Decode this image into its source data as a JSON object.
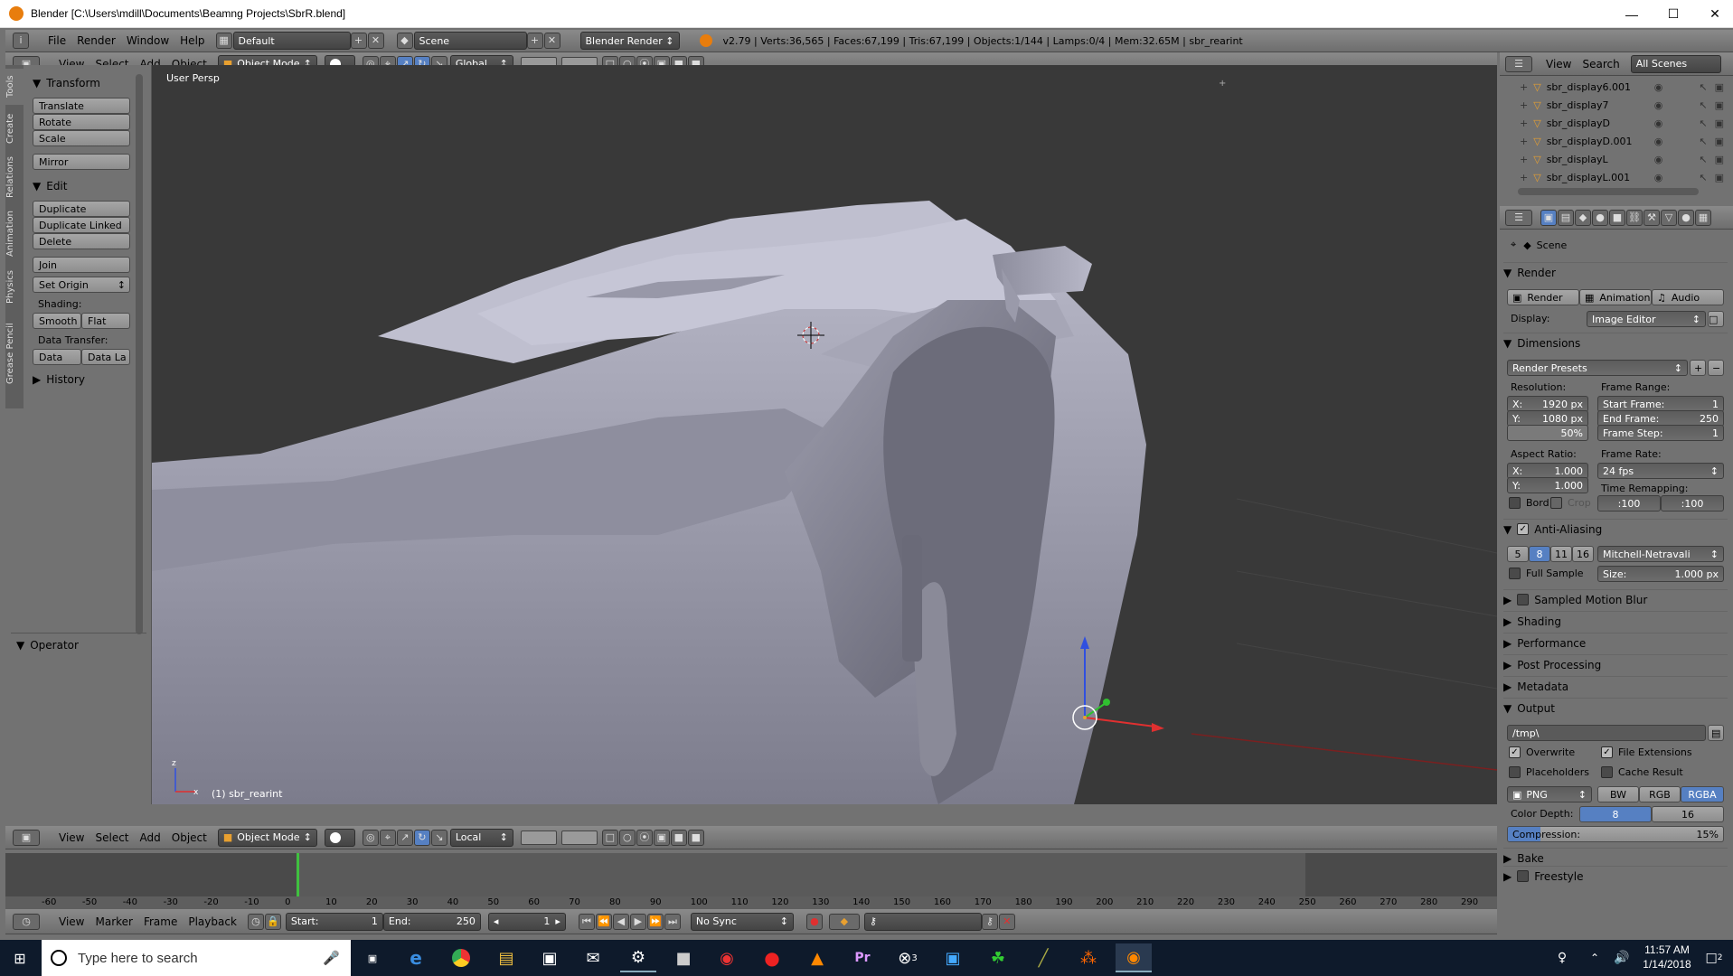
{
  "window": {
    "title": "Blender [C:\\Users\\mdill\\Documents\\Beamng Projects\\SbrR.blend]"
  },
  "info_bar": {
    "menus": [
      "File",
      "Render",
      "Window",
      "Help"
    ],
    "layout": "Default",
    "scene": "Scene",
    "engine": "Blender Render",
    "stats": "v2.79 | Verts:36,565 | Faces:67,199 | Tris:67,199 | Objects:1/144 | Lamps:0/4 | Mem:32.65M | sbr_rearint"
  },
  "view3d_header": {
    "menus": [
      "View",
      "Select",
      "Add",
      "Object"
    ],
    "mode": "Object Mode",
    "orientation": "Global"
  },
  "view3d_header_bottom": {
    "menus": [
      "View",
      "Select",
      "Add",
      "Object"
    ],
    "mode": "Object Mode",
    "orientation": "Local"
  },
  "tool_tabs": [
    "Tools",
    "Create",
    "Relations",
    "Animation",
    "Physics",
    "Grease Pencil"
  ],
  "toolshelf": {
    "transform": {
      "title": "Transform",
      "buttons": [
        "Translate",
        "Rotate",
        "Scale",
        "Mirror"
      ]
    },
    "edit": {
      "title": "Edit",
      "buttons": [
        "Duplicate",
        "Duplicate Linked",
        "Delete",
        "Join"
      ],
      "set_origin": "Set Origin"
    },
    "shading": {
      "label": "Shading:",
      "smooth": "Smooth",
      "flat": "Flat"
    },
    "data_transfer": {
      "label": "Data Transfer:",
      "data": "Data",
      "data_la": "Data La"
    },
    "history": "History",
    "operator": "Operator"
  },
  "viewport": {
    "label": "User Persp",
    "object_label": "(1) sbr_rearint",
    "axis_x": "x",
    "axis_z": "z"
  },
  "outliner": {
    "menus": [
      "View",
      "Search"
    ],
    "filter": "All Scenes",
    "items": [
      "sbr_display6.001",
      "sbr_display7",
      "sbr_displayD",
      "sbr_displayD.001",
      "sbr_displayL",
      "sbr_displayL.001"
    ]
  },
  "properties": {
    "context": "Scene",
    "render": {
      "title": "Render",
      "buttons": [
        "Render",
        "Animation",
        "Audio"
      ],
      "display_label": "Display:",
      "display_value": "Image Editor"
    },
    "dimensions": {
      "title": "Dimensions",
      "presets": "Render Presets",
      "resolution_label": "Resolution:",
      "res_x": "X:",
      "res_x_val": "1920 px",
      "res_y": "Y:",
      "res_y_val": "1080 px",
      "res_pct": "50%",
      "frame_range_label": "Frame Range:",
      "start_frame": "Start Frame:",
      "start_val": "1",
      "end_frame": "End Frame:",
      "end_val": "250",
      "frame_step": "Frame Step:",
      "step_val": "1",
      "aspect_label": "Aspect Ratio:",
      "asp_x": "X:",
      "asp_x_val": "1.000",
      "asp_y": "Y:",
      "asp_y_val": "1.000",
      "frame_rate_label": "Frame Rate:",
      "frame_rate": "24 fps",
      "time_remap_label": "Time Remapping:",
      "remap_old": ":100",
      "remap_new": ":100",
      "bord": "Bord",
      "crop": "Crop"
    },
    "anti_aliasing": {
      "title": "Anti-Aliasing",
      "samples": [
        "5",
        "8",
        "11",
        "16"
      ],
      "filter": "Mitchell-Netravali",
      "full_sample": "Full Sample",
      "size_label": "Size:",
      "size_val": "1.000 px"
    },
    "collapsed": [
      "Sampled Motion Blur",
      "Shading",
      "Performance",
      "Post Processing",
      "Metadata"
    ],
    "output": {
      "title": "Output",
      "path": "/tmp\\",
      "overwrite": "Overwrite",
      "file_extensions": "File Extensions",
      "placeholders": "Placeholders",
      "cache_result": "Cache Result",
      "format": "PNG",
      "color_modes": [
        "BW",
        "RGB",
        "RGBA"
      ],
      "color_depth_label": "Color Depth:",
      "depths": [
        "8",
        "16"
      ],
      "compression_label": "Compression:",
      "compression": "15%",
      "compression_value": 0.15
    },
    "bake": "Bake",
    "freestyle": "Freestyle"
  },
  "timeline": {
    "ticks": [
      "-60",
      "-50",
      "-40",
      "-30",
      "-20",
      "-10",
      "0",
      "10",
      "20",
      "30",
      "40",
      "50",
      "60",
      "70",
      "80",
      "90",
      "100",
      "110",
      "120",
      "130",
      "140",
      "150",
      "160",
      "170",
      "180",
      "190",
      "200",
      "210",
      "220",
      "230",
      "240",
      "250",
      "260",
      "270",
      "280",
      "290"
    ],
    "menus": [
      "View",
      "Marker",
      "Frame",
      "Playback"
    ],
    "start_label": "Start:",
    "start_val": "1",
    "end_label": "End:",
    "end_val": "250",
    "current": "1",
    "sync": "No Sync"
  },
  "taskbar": {
    "search_placeholder": "Type here to search",
    "time": "11:57 AM",
    "date": "1/14/2018",
    "notif_count": "2",
    "xbox_badge": "3"
  },
  "colors": {
    "viewport_bg": "#393939",
    "panel_bg": "#727272",
    "header": "#7a7a7a",
    "selected": "#5680c2",
    "axis_x": "#e03030",
    "axis_y": "#30c030",
    "axis_z": "#3050e0",
    "taskbar": "#0e1a2b"
  }
}
